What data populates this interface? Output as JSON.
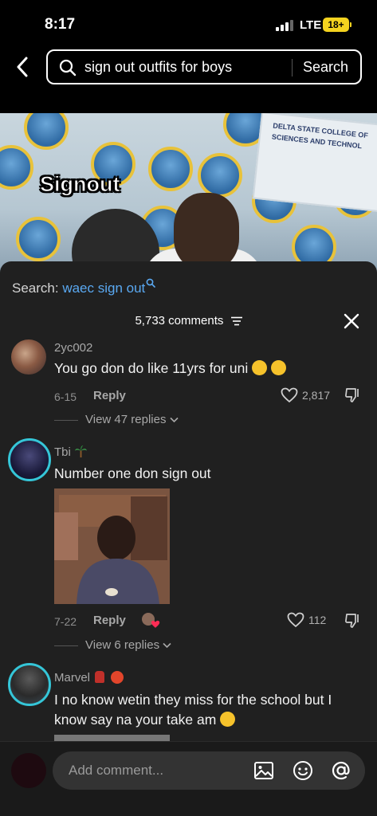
{
  "status_bar": {
    "time": "8:17",
    "network": "LTE",
    "battery": "18+"
  },
  "search": {
    "query": "sign out outfits for boys",
    "submit_label": "Search"
  },
  "video": {
    "caption": "Signout",
    "banner_line1": "DELTA STATE COLLEGE OF",
    "banner_line2": "SCIENCES AND TECHNOL"
  },
  "comments_panel": {
    "related_prefix": "Search:",
    "related_query": "waec sign out",
    "count_label": "5,733 comments"
  },
  "comments": [
    {
      "username": "2yc002",
      "text": "You go don do like 11yrs for uni",
      "date": "6-15",
      "reply_label": "Reply",
      "likes": "2,817",
      "view_replies": "View 47 replies"
    },
    {
      "username": "Tbi",
      "text": "Number one don sign out",
      "date": "7-22",
      "reply_label": "Reply",
      "likes": "112",
      "view_replies": "View 6 replies"
    },
    {
      "username": "Marvel",
      "text": "I no know wetin they miss for the school but I know say na your take am",
      "date": "",
      "reply_label": "",
      "likes": "",
      "view_replies": ""
    }
  ],
  "composer": {
    "placeholder": "Add comment..."
  },
  "colors": {
    "accent_link": "#5aa9f2",
    "ring": "#35c6d8",
    "battery": "#f4d31f",
    "sheet_bg": "#202020"
  },
  "icons": [
    "back-arrow-icon",
    "search-icon",
    "filter-icon",
    "close-icon",
    "heart-icon",
    "dislike-icon",
    "chevron-down-icon",
    "image-icon",
    "emoji-icon",
    "mention-icon"
  ]
}
